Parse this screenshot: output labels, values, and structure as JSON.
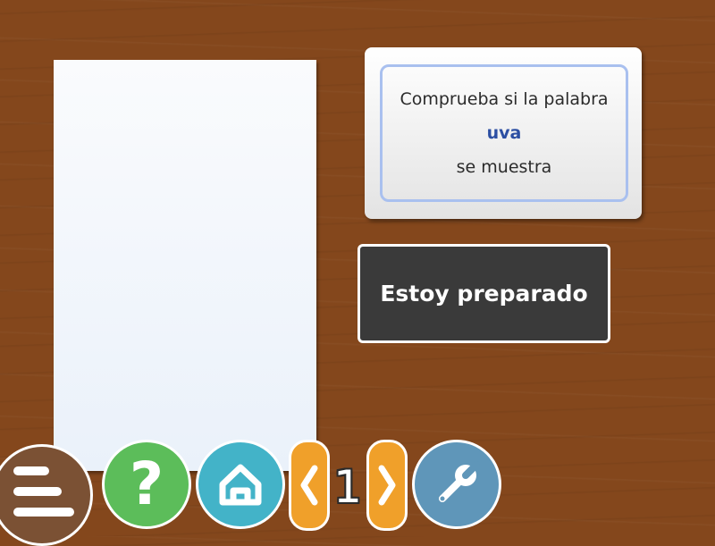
{
  "instruction": {
    "line1": "Comprueba si la palabra",
    "word": "uva",
    "line3": "se muestra"
  },
  "ready_button": {
    "label": "Estoy preparado"
  },
  "toolbar": {
    "help_glyph": "?",
    "page_number": "1",
    "icons": [
      "menu-icon",
      "question-icon",
      "home-icon",
      "chevron-left-icon",
      "chevron-right-icon",
      "wrench-icon"
    ]
  },
  "colors": {
    "background_wood": "#84471c",
    "card": "#f3f6fb",
    "ready_button_bg": "#3a3a3a",
    "instruction_border": "#a9c0ef",
    "word": "#2c4fa3",
    "help_button": "#5cbd5a",
    "home_button": "#43b3c8",
    "arrow_buttons": "#f0a02a",
    "settings_button": "#5f96b9",
    "menu_button": "#7b5134"
  }
}
